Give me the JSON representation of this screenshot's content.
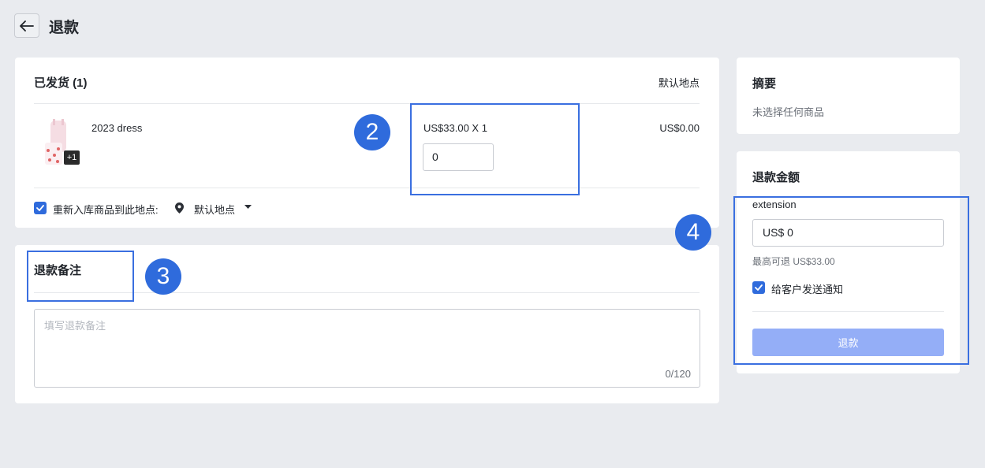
{
  "header": {
    "title": "退款"
  },
  "shipped": {
    "title": "已发货 (1)",
    "location": "默认地点",
    "item": {
      "name": "2023 dress",
      "extra_badge": "+1",
      "price_qty": "US$33.00 X 1",
      "qty_value": "0",
      "line_total": "US$0.00"
    },
    "restock_label": "重新入库商品到此地点:",
    "restock_location": "默认地点"
  },
  "note": {
    "title": "退款备注",
    "placeholder": "填写退款备注",
    "counter": "0/120"
  },
  "summary": {
    "title": "摘要",
    "empty_text": "未选择任何商品"
  },
  "refund": {
    "title": "退款金额",
    "field_label": "extension",
    "amount_value": "US$ 0",
    "max_text": "最高可退 US$33.00",
    "notify_label": "给客户发送通知",
    "button_label": "退款"
  },
  "annotations": {
    "step2": "2",
    "step3": "3",
    "step4": "4"
  },
  "colors": {
    "accent": "#2f6bdc",
    "highlight": "#3a6fe0",
    "disabled_button": "#94aef7"
  }
}
